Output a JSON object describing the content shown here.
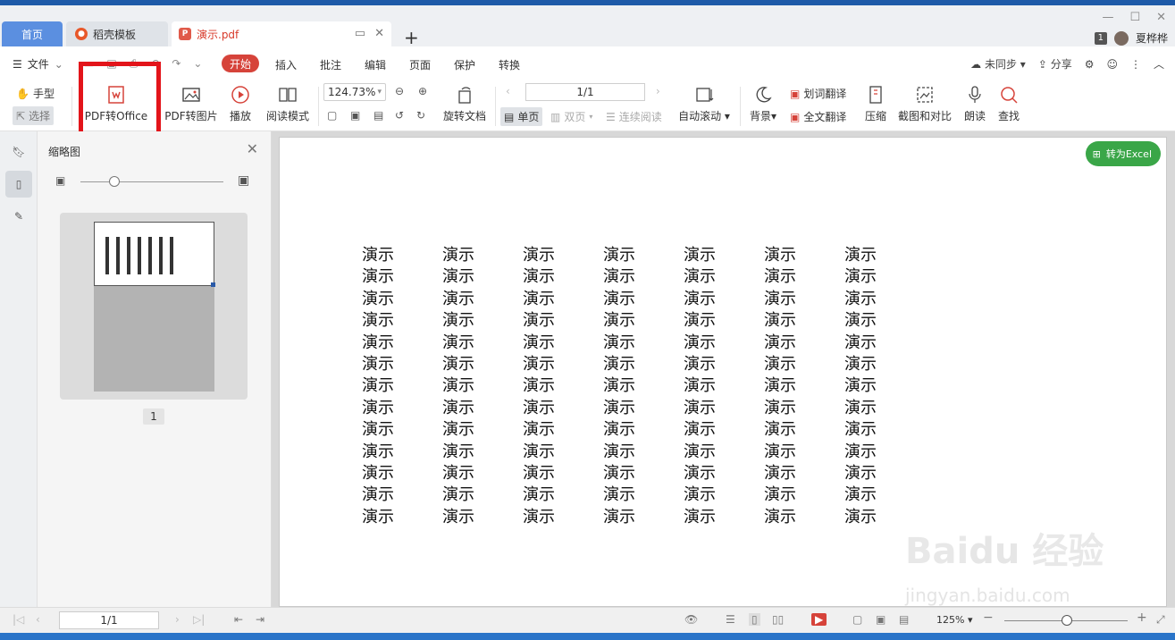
{
  "tabs": {
    "home": "首页",
    "template": "稻壳模板",
    "document": "演示.pdf"
  },
  "user": {
    "count": "1",
    "name": "夏桦桦"
  },
  "menu": {
    "file": "文件",
    "start": "开始",
    "items": [
      "插入",
      "批注",
      "编辑",
      "页面",
      "保护",
      "转换"
    ],
    "sync": "未同步",
    "share": "分享"
  },
  "ribbon": {
    "hand": "手型",
    "select": "选择",
    "pdf_to_office": "PDF转Office",
    "pdf_to_image": "PDF转图片",
    "play": "播放",
    "read_mode": "阅读模式",
    "zoom": "124.73%",
    "rotate_doc": "旋转文档",
    "page_input": "1/1",
    "single_page": "单页",
    "double_page": "双页",
    "continuous": "连续阅读",
    "auto_scroll": "自动滚动",
    "background": "背景",
    "word_translate": "划词翻译",
    "full_translate": "全文翻译",
    "compress": "压缩",
    "screenshot_compare": "截图和对比",
    "read_aloud": "朗读",
    "find": "查找"
  },
  "thumbnail_panel": {
    "title": "缩略图",
    "page_number": "1"
  },
  "document": {
    "convert_excel": "转为Excel",
    "cell_text": "演示",
    "rows": 13,
    "cols": 7
  },
  "statusbar": {
    "page": "1/1",
    "zoom": "125%"
  },
  "colors": {
    "accent_red": "#d6433a",
    "tab_blue": "#5b8fe0",
    "excel_green": "#3aa648",
    "highlight_box": "#e3141a"
  }
}
